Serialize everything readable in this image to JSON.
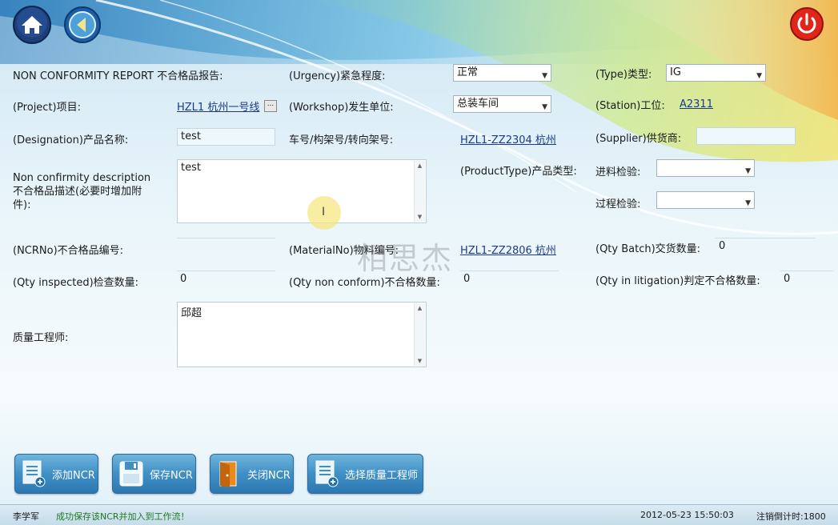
{
  "toolbar": {
    "home_icon": "home-icon",
    "back_icon": "back-arrow-icon",
    "power_icon": "power-icon"
  },
  "form": {
    "report_title": "NON CONFORMITY REPORT 不合格品报告:",
    "urgency_label": "(Urgency)紧急程度:",
    "urgency_value": "正常",
    "type_label": "(Type)类型:",
    "type_value": "IG",
    "project_label": "(Project)项目:",
    "project_value": "HZL1 杭州一号线",
    "workshop_label": "(Workshop)发生单位:",
    "workshop_value": "总装车间",
    "station_label": "(Station)工位:",
    "station_value": "A2311",
    "designation_label": "(Designation)产品名称:",
    "designation_value": "test",
    "car_label": "车号/构架号/转向架号:",
    "car_value": "HZL1-ZZ2304 杭州",
    "supplier_label": "(Supplier)供货商:",
    "supplier_value": "",
    "desc_label_en": "Non confirmity description",
    "desc_label_cn": "不合格品描述(必要时增加附件):",
    "desc_value": "test",
    "product_type_label": "(ProductType)产品类型:",
    "incoming_label": "进料检验:",
    "incoming_value": "",
    "process_label": "过程检验:",
    "process_value": "",
    "ncrno_label": "(NCRNo)不合格品编号:",
    "ncrno_value": "",
    "material_label": "(MaterialNo)物料编号:",
    "material_value": "HZL1-ZZ2806 杭州",
    "qty_batch_label": "(Qty Batch)交货数量:",
    "qty_batch_value": "0",
    "qty_inspected_label": "(Qty inspected)检查数量:",
    "qty_inspected_value": "0",
    "qty_nonconform_label": "(Qty non conform)不合格数量:",
    "qty_nonconform_value": "0",
    "qty_litigation_label": "(Qty in litigation)判定不合格数量:",
    "qty_litigation_value": "0",
    "engineer_label": "质量工程师:",
    "engineer_value": "邱超"
  },
  "watermark": "相思杰",
  "buttons": {
    "add": "添加NCR",
    "save": "保存NCR",
    "close": "关闭NCR",
    "select_engineer": "选择质量工程师"
  },
  "status": {
    "user": "李学军",
    "message": "成功保存该NCR并加入到工作流！",
    "datetime": "2012-05-23 15:50:03",
    "countdown": "注销倒计时:1800"
  },
  "colors": {
    "status_message": "#1f7a1f",
    "button": "#3f8fc5",
    "power": "#e0251b"
  }
}
